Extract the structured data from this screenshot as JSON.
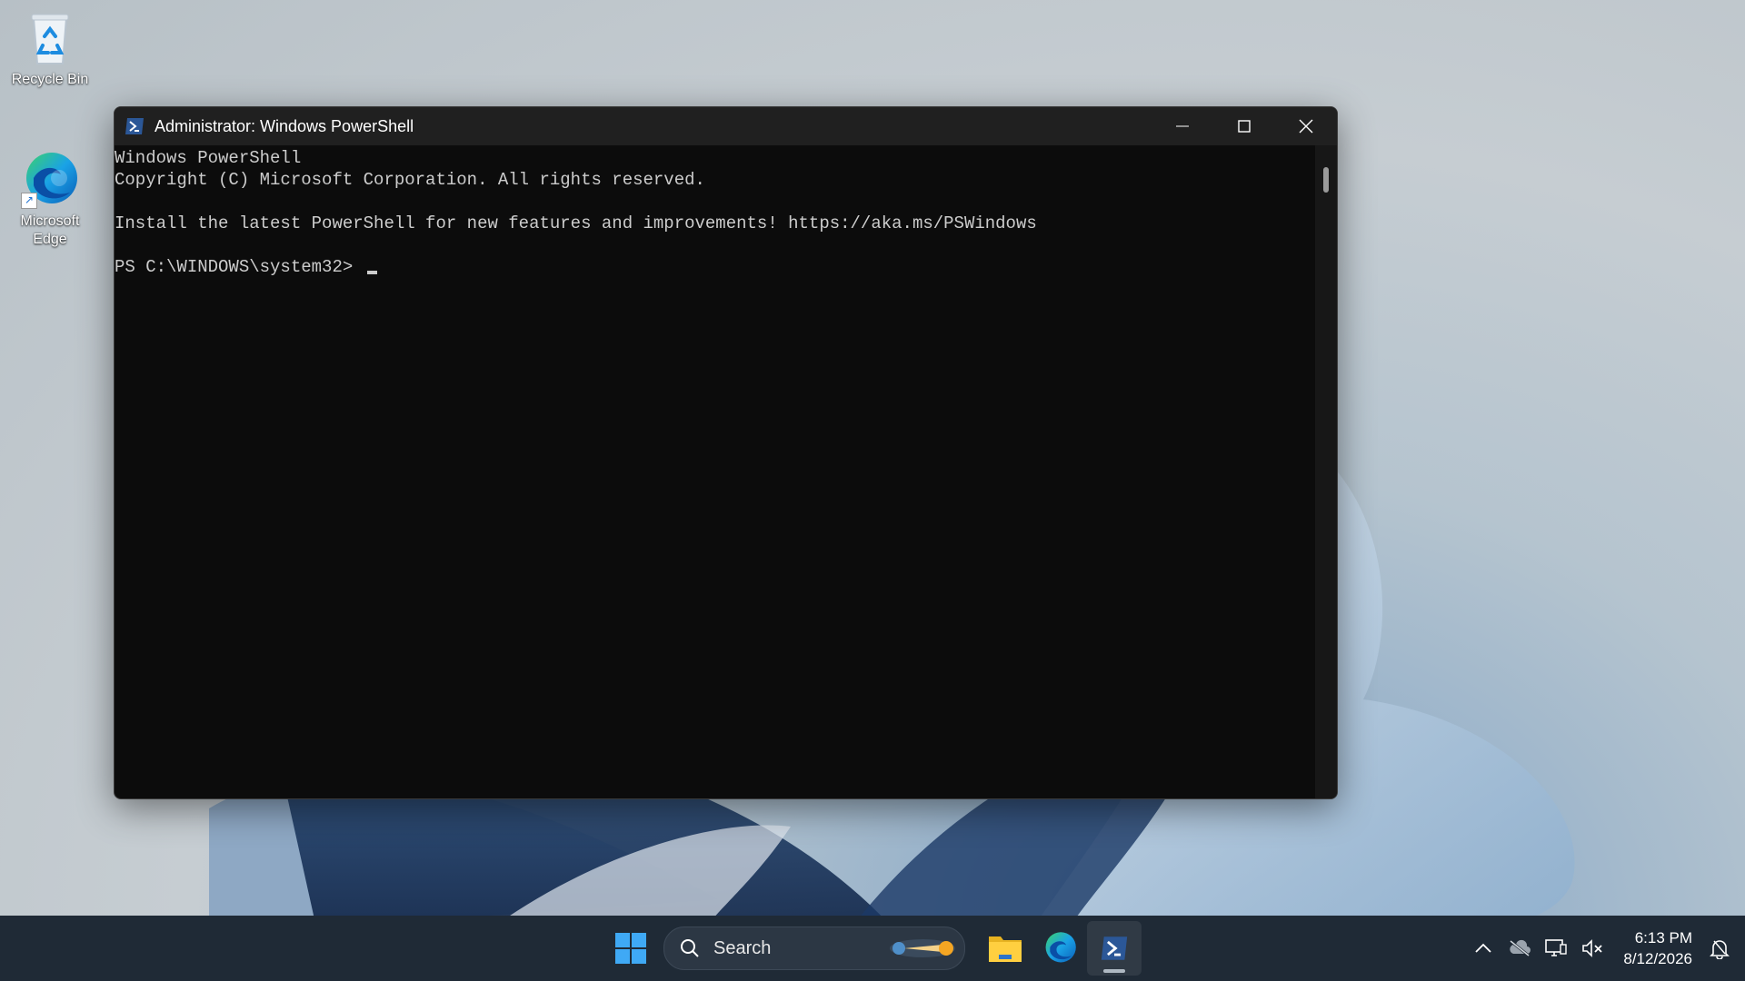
{
  "desktop": {
    "icons": [
      {
        "label": "Recycle Bin"
      },
      {
        "label": "Microsoft Edge"
      }
    ]
  },
  "window": {
    "title": "Administrator: Windows PowerShell",
    "console_lines": [
      "Windows PowerShell",
      "Copyright (C) Microsoft Corporation. All rights reserved.",
      "",
      "Install the latest PowerShell for new features and improvements! https://aka.ms/PSWindows",
      "",
      "PS C:\\WINDOWS\\system32> "
    ]
  },
  "taskbar": {
    "search_placeholder": "Search",
    "pinned": [
      "start-icon",
      "file-explorer-icon",
      "edge-icon",
      "powershell-icon"
    ],
    "clock_time": "6:13 PM",
    "clock_date": "8/12/2026"
  },
  "colors": {
    "console_bg": "#0c0c0c",
    "console_text": "#cccccc",
    "titlebar_bg": "#202020",
    "taskbar_bg": "#1f2a36"
  }
}
